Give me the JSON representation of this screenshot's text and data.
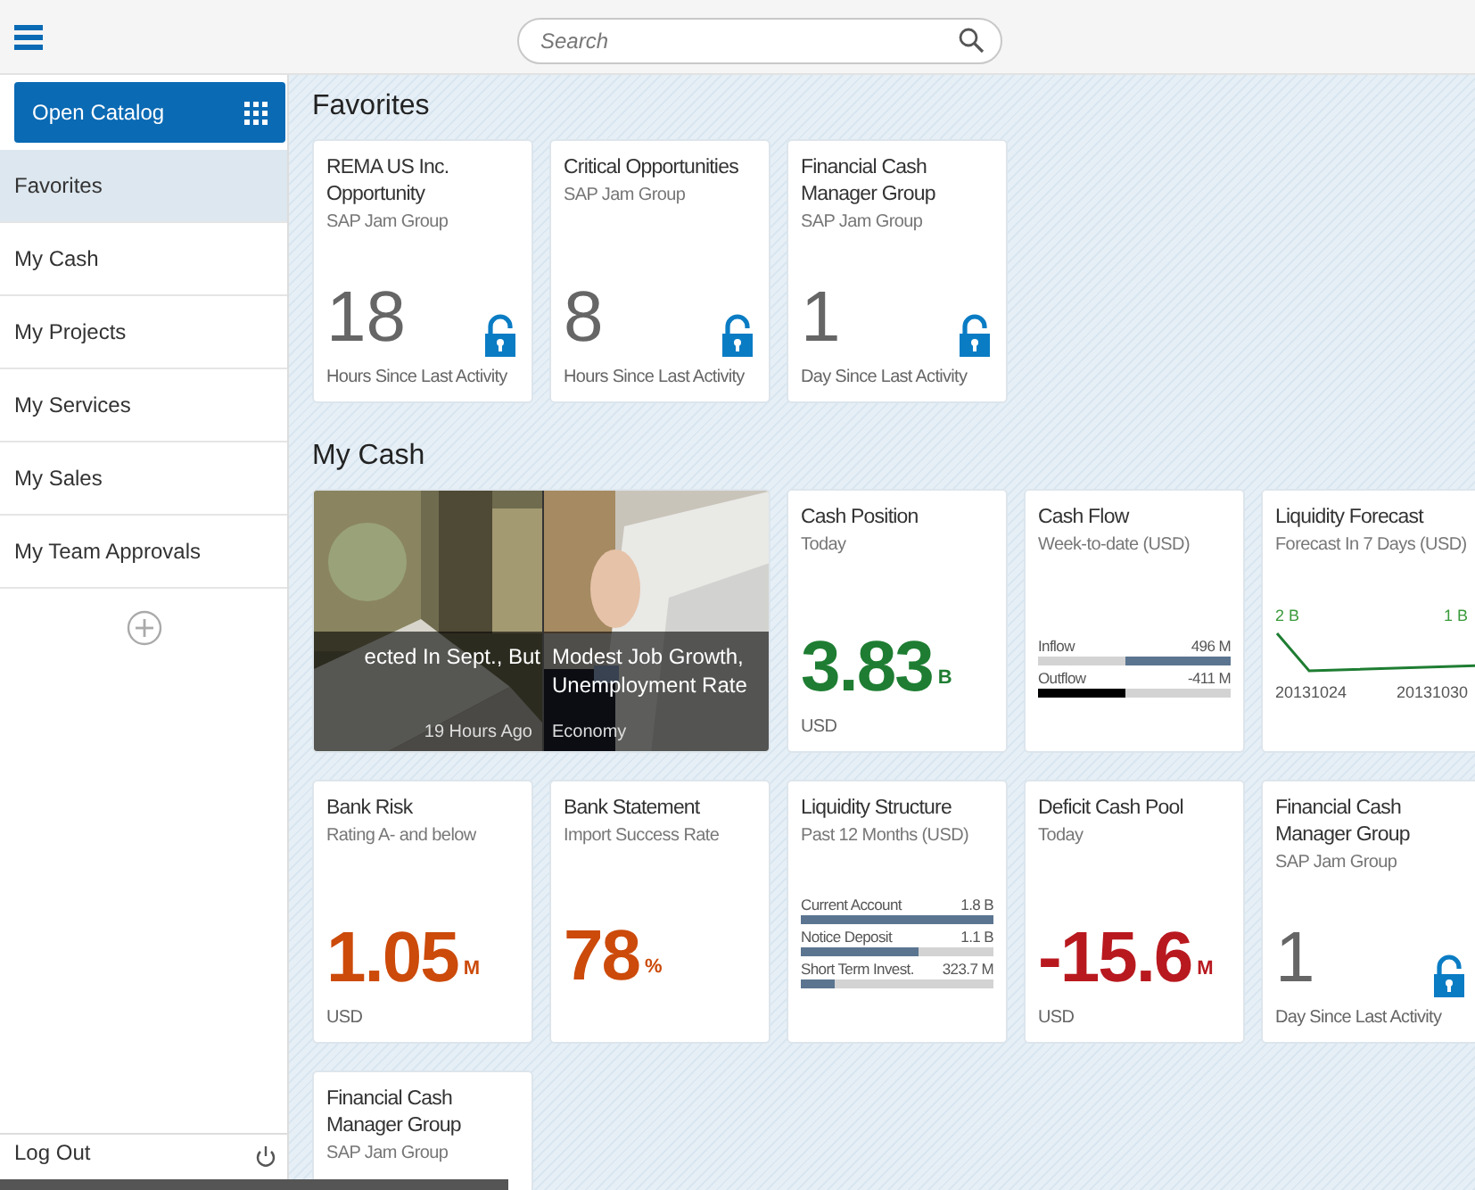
{
  "search": {
    "placeholder": "Search"
  },
  "sidebar": {
    "catalog_button": "Open Catalog",
    "items": [
      {
        "label": "Favorites",
        "selected": true
      },
      {
        "label": "My Cash",
        "selected": false
      },
      {
        "label": "My Projects",
        "selected": false
      },
      {
        "label": "My Services",
        "selected": false
      },
      {
        "label": "My Sales",
        "selected": false
      },
      {
        "label": "My Team Approvals",
        "selected": false
      }
    ],
    "logout": "Log Out"
  },
  "groups": [
    {
      "title": "Favorites",
      "tiles": [
        {
          "kind": "favorite",
          "title": "REMA US Inc. Opportunity",
          "subtitle": "SAP Jam Group",
          "value": "18",
          "footer": "Hours Since Last Activity"
        },
        {
          "kind": "favorite",
          "title": "Critical Opportunities",
          "subtitle": "SAP Jam Group",
          "value": "8",
          "footer": "Hours Since Last Activity"
        },
        {
          "kind": "favorite",
          "title": "Financial Cash Manager Group",
          "subtitle": "SAP Jam Group",
          "value": "1",
          "footer": "Day Since Last Activity"
        }
      ]
    },
    {
      "title": "My Cash",
      "tiles": [
        {
          "kind": "news",
          "articles": [
            {
              "headline": "ected In Sept., But",
              "meta": "19 Hours Ago"
            },
            {
              "headline": "Modest Job Growth, Unemployment Rate",
              "meta": "Economy"
            }
          ]
        },
        {
          "kind": "kpi",
          "title": "Cash Position",
          "subtitle": "Today",
          "value": "3.83",
          "unit": "B",
          "footer": "USD",
          "color": "#1e7d32"
        },
        {
          "kind": "bars",
          "title": "Cash Flow",
          "subtitle": "Week-to-date (USD)",
          "bars": [
            {
              "kind": "inflow",
              "label": "Inflow",
              "reading": "496 M",
              "level": 0.55
            },
            {
              "kind": "outflow",
              "label": "Outflow",
              "reading": "-411 M",
              "level": 0.45
            }
          ]
        },
        {
          "kind": "forecast",
          "title": "Liquidity Forecast",
          "subtitle": "Forecast In 7 Days (USD)",
          "start_label": "2 B",
          "end_label": "1 B",
          "start_date": "20131024",
          "end_date": "20131030"
        },
        {
          "kind": "kpi",
          "title": "Bank Risk",
          "subtitle": "Rating A- and below",
          "value": "1.05",
          "unit": "M",
          "footer": "USD",
          "color": "#cc4a0a"
        },
        {
          "kind": "kpi",
          "title": "Bank Statement",
          "subtitle": "Import Success Rate",
          "value": "78",
          "unit": "%",
          "color": "#cc4a0a"
        },
        {
          "kind": "bars",
          "title": "Liquidity Structure",
          "subtitle": "Past 12 Months (USD)",
          "bars": [
            {
              "kind": "plain",
              "label": "Current Account",
              "reading": "1.8 B",
              "level": 1
            },
            {
              "kind": "plain",
              "label": "Notice Deposit",
              "reading": "1.1 B",
              "level": 0.61
            },
            {
              "kind": "plain",
              "label": "Short Term Invest.",
              "reading": "323.7 M",
              "level": 0.18
            }
          ]
        },
        {
          "kind": "kpi",
          "title": "Deficit Cash Pool",
          "subtitle": "Today",
          "value": "-15.6",
          "unit": "M",
          "footer": "USD",
          "color": "#b8191f"
        },
        {
          "kind": "favorite",
          "title": "Financial Cash Manager Group",
          "subtitle": "SAP Jam Group",
          "value": "1",
          "footer": "Day Since Last Activity"
        },
        {
          "kind": "favorite",
          "title": "Financial Cash Manager Group",
          "subtitle": "SAP Jam Group"
        }
      ]
    }
  ]
}
